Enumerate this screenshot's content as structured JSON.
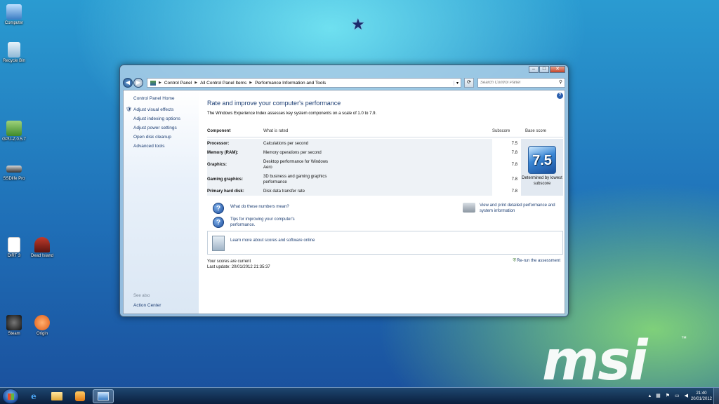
{
  "desktop": {
    "icons": [
      {
        "label": "Computer"
      },
      {
        "label": "Recycle Bin"
      },
      {
        "label": "GPU-Z.0.5.7"
      },
      {
        "label": "SSDlife Pro"
      },
      {
        "label": "DiRT 3"
      },
      {
        "label": "Dead Island"
      },
      {
        "label": "Steam"
      },
      {
        "label": "Origin"
      }
    ],
    "logo": "msi",
    "logo_tm": "™"
  },
  "window": {
    "address": {
      "segments": [
        "Control Panel",
        "All Control Panel Items",
        "Performance Information and Tools"
      ]
    },
    "search_placeholder": "Search Control Panel",
    "left_pane": {
      "home": "Control Panel Home",
      "links": [
        "Adjust visual effects",
        "Adjust indexing options",
        "Adjust power settings",
        "Open disk cleanup",
        "Advanced tools"
      ],
      "see_also": "See also",
      "action_center": "Action Center"
    },
    "main": {
      "title": "Rate and improve your computer's performance",
      "description": "The Windows Experience Index assesses key system components on a scale of 1.0 to 7.9.",
      "table": {
        "headers": {
          "component": "Component",
          "rated": "What is rated",
          "subscore": "Subscore",
          "base": "Base score"
        },
        "rows": [
          {
            "component": "Processor:",
            "rated": "Calculations per second",
            "subscore": "7.5"
          },
          {
            "component": "Memory (RAM):",
            "rated": "Memory operations per second",
            "subscore": "7.8"
          },
          {
            "component": "Graphics:",
            "rated": "Desktop performance for Windows Aero",
            "subscore": "7.8"
          },
          {
            "component": "Gaming graphics:",
            "rated": "3D business and gaming graphics performance",
            "subscore": "7.8"
          },
          {
            "component": "Primary hard disk:",
            "rated": "Disk data transfer rate",
            "subscore": "7.8"
          }
        ],
        "base_score": "7.5",
        "base_caption": "Determined by lowest subscore"
      },
      "link_numbers": "What do these numbers mean?",
      "link_tips": "Tips for improving your computer's performance.",
      "link_print": "View and print detailed performance and system information",
      "link_learn": "Learn more about scores and software online",
      "status_current": "Your scores are current",
      "status_update": "Last update: 20/01/2012 21:35:37",
      "rerun": "Re-run the assessment"
    }
  },
  "taskbar": {
    "time": "21:40",
    "date": "20/01/2012"
  }
}
